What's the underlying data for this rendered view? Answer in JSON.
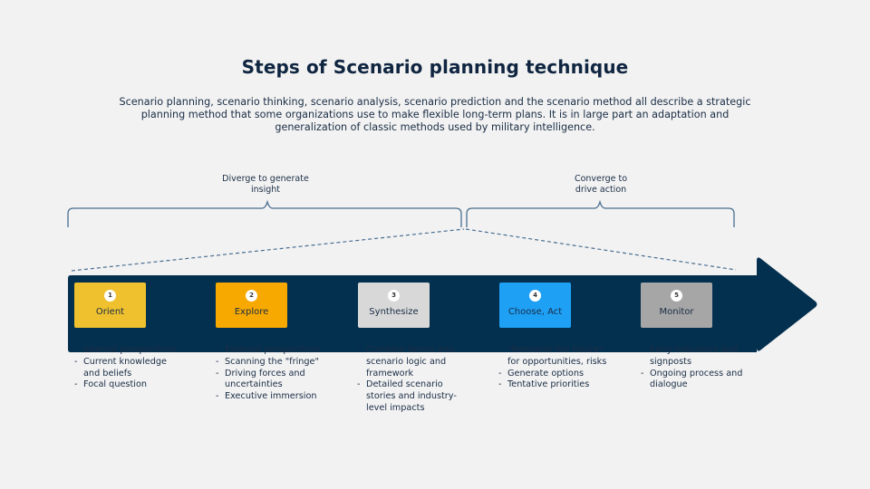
{
  "title": "Steps of Scenario planning technique",
  "subtitle": "Scenario planning, scenario thinking, scenario analysis, scenario prediction and the scenario method all describe a strategic planning method that some organizations use to make flexible long-term plans. It is in large part an adaptation and generalization of classic methods used by military intelligence.",
  "phases": [
    {
      "label_line1": "Diverge to generate",
      "label_line2": "insight"
    },
    {
      "label_line1": "Converge to",
      "label_line2": "drive action"
    }
  ],
  "colors": {
    "background": "#f2f2f2",
    "arrow": "#04304f",
    "bracket": "#4a6f91",
    "title": "#0f2540"
  },
  "steps": [
    {
      "number": "1",
      "label": "Orient",
      "color": "#f0c12e",
      "bullets": [
        "Internal perspectives",
        "Current knowledge and beliefs",
        "Focal question"
      ]
    },
    {
      "number": "2",
      "label": "Explore",
      "color": "#f8a900",
      "bullets": [
        "External perspectives",
        "Scanning the \"fringe\"",
        "Driving forces and uncertainties",
        "Executive immersion"
      ]
    },
    {
      "number": "3",
      "label": "Synthesize",
      "color": "#d8d8d8",
      "bullets": [
        "Combine forces into scenario logic and framework",
        "Detailed scenario stories and industry-level impacts"
      ]
    },
    {
      "number": "4",
      "label": "Choose, Act",
      "color": "#1ea0f5",
      "bullets": [
        "\"Rehearse the future\" for opportunities, risks",
        "Generate options",
        "Tentative priorities"
      ]
    },
    {
      "number": "5",
      "label": "Monitor",
      "color": "#a6a6a6",
      "bullets": [
        "Early indicators and signposts",
        "Ongoing process and dialogue"
      ]
    }
  ]
}
